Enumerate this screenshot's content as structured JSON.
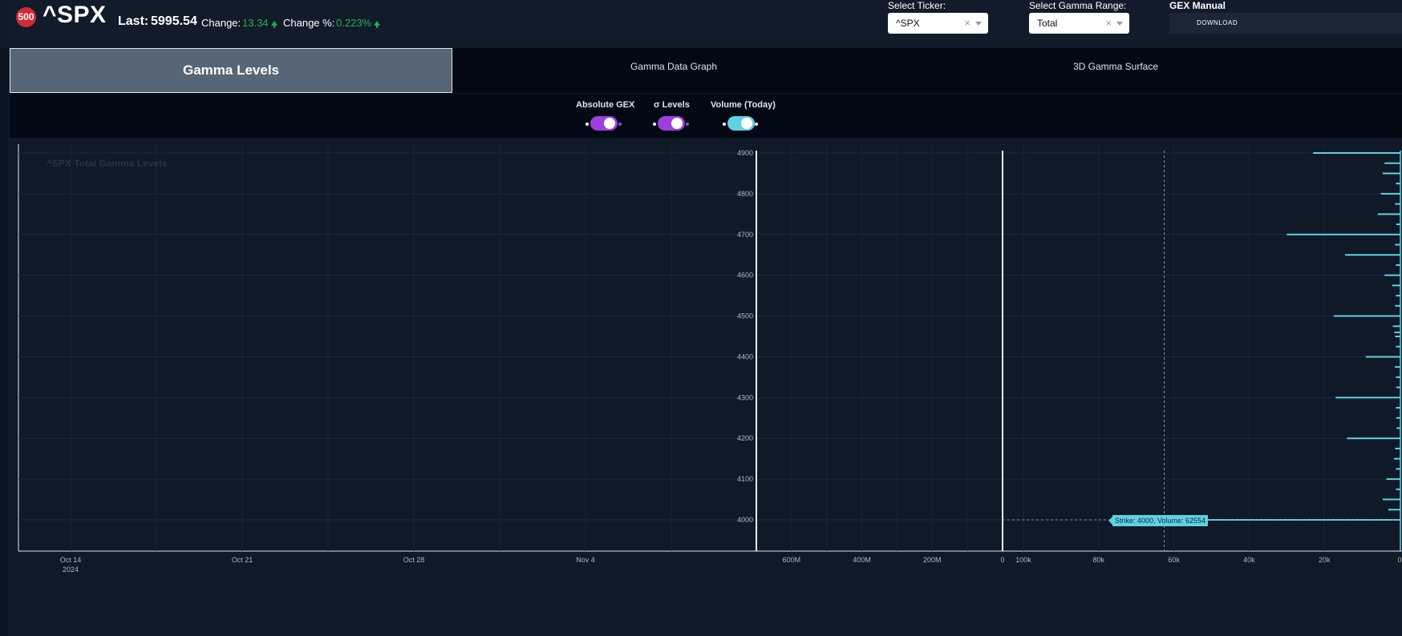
{
  "header": {
    "logo": "500",
    "ticker": "^SPX",
    "last_label": "Last:",
    "last_value": "5995.54",
    "change_label": "Change:",
    "change_value": "13.34",
    "change_pct_label": "Change %:",
    "change_pct_value": "0.223%",
    "up_color": "#22b14c",
    "select_ticker_label": "Select Ticker:",
    "select_ticker_value": "^SPX",
    "select_range_label": "Select Gamma Range:",
    "select_range_value": "Total",
    "clear_glyph": "×",
    "gex_manual_label": "GEX Manual",
    "download_label": "DOWNLOAD"
  },
  "tabs": [
    {
      "label": "Gamma Levels",
      "active": true
    },
    {
      "label": "Gamma Data Graph",
      "active": false
    },
    {
      "label": "3D Gamma Surface",
      "active": false
    }
  ],
  "toggles": [
    {
      "label": "Absolute GEX",
      "on": true,
      "color": "#9d3fdc"
    },
    {
      "label": "σ Levels",
      "on": true,
      "color": "#9d3fdc"
    },
    {
      "label": "Volume (Today)",
      "on": true,
      "color": "#5fd1e3"
    }
  ],
  "chart_data": {
    "type": "bar",
    "title": "^SPX Total Gamma Levels",
    "ylabel": "",
    "y_ticks": [
      4900,
      4800,
      4700,
      4600,
      4500,
      4400,
      4300,
      4200,
      4100,
      4000
    ],
    "ylim": [
      3921,
      4900
    ],
    "x_date_ticks": [
      "Oct 14",
      "Oct 21",
      "Oct 28",
      "Nov 4"
    ],
    "x_date_year": "2024",
    "gex_xlim": [
      0,
      700
    ],
    "gex_ticks": [
      {
        "value": 600,
        "label": "600M"
      },
      {
        "value": 400,
        "label": "400M"
      },
      {
        "value": 200,
        "label": "200M"
      },
      {
        "value": 0,
        "label": "0"
      }
    ],
    "volume_xlim": [
      0,
      110000
    ],
    "volume_ticks": [
      {
        "value": 100000,
        "label": "100k"
      },
      {
        "value": 80000,
        "label": "80k"
      },
      {
        "value": 60000,
        "label": "60k"
      },
      {
        "value": 40000,
        "label": "40k"
      },
      {
        "value": 20000,
        "label": "20k"
      },
      {
        "value": 0,
        "label": "0"
      }
    ],
    "volume_color": "#5fd1e3",
    "volume_series": [
      {
        "strike": 4900,
        "volume": 23000
      },
      {
        "strike": 4875,
        "volume": 4000
      },
      {
        "strike": 4850,
        "volume": 4500
      },
      {
        "strike": 4825,
        "volume": 1000
      },
      {
        "strike": 4800,
        "volume": 5000
      },
      {
        "strike": 4775,
        "volume": 1200
      },
      {
        "strike": 4750,
        "volume": 5800
      },
      {
        "strike": 4725,
        "volume": 900
      },
      {
        "strike": 4700,
        "volume": 30000
      },
      {
        "strike": 4675,
        "volume": 1200
      },
      {
        "strike": 4650,
        "volume": 14500
      },
      {
        "strike": 4625,
        "volume": 1000
      },
      {
        "strike": 4600,
        "volume": 4000
      },
      {
        "strike": 4575,
        "volume": 2000
      },
      {
        "strike": 4550,
        "volume": 1000
      },
      {
        "strike": 4525,
        "volume": 1200
      },
      {
        "strike": 4500,
        "volume": 17500
      },
      {
        "strike": 4475,
        "volume": 1800
      },
      {
        "strike": 4460,
        "volume": 1400
      },
      {
        "strike": 4450,
        "volume": 1200
      },
      {
        "strike": 4425,
        "volume": 1000
      },
      {
        "strike": 4400,
        "volume": 9000
      },
      {
        "strike": 4375,
        "volume": 1300
      },
      {
        "strike": 4350,
        "volume": 1000
      },
      {
        "strike": 4325,
        "volume": 900
      },
      {
        "strike": 4300,
        "volume": 17000
      },
      {
        "strike": 4275,
        "volume": 1000
      },
      {
        "strike": 4250,
        "volume": 900
      },
      {
        "strike": 4225,
        "volume": 800
      },
      {
        "strike": 4200,
        "volume": 14000
      },
      {
        "strike": 4175,
        "volume": 1200
      },
      {
        "strike": 4150,
        "volume": 1500
      },
      {
        "strike": 4125,
        "volume": 1000
      },
      {
        "strike": 4100,
        "volume": 3500
      },
      {
        "strike": 4075,
        "volume": 1000
      },
      {
        "strike": 4050,
        "volume": 4500
      },
      {
        "strike": 4025,
        "volume": 3000
      },
      {
        "strike": 4000,
        "volume": 62554
      }
    ],
    "tooltip": "Strike: 4000, Volume: 62554"
  }
}
